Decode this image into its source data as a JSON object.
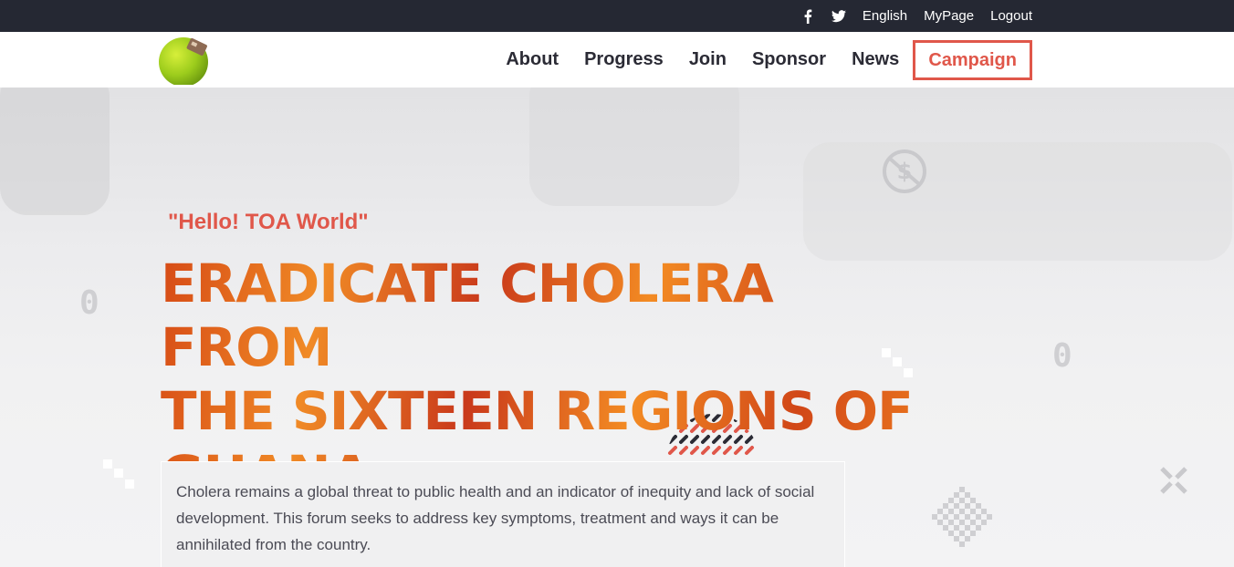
{
  "topbar": {
    "social": [
      {
        "name": "facebook-icon",
        "glyph": "f"
      },
      {
        "name": "twitter-icon",
        "glyph": "🐦"
      }
    ],
    "links": [
      {
        "label": "English"
      },
      {
        "label": "MyPage"
      },
      {
        "label": "Logout"
      }
    ]
  },
  "nav": {
    "items": [
      {
        "label": "About"
      },
      {
        "label": "Progress"
      },
      {
        "label": "Join"
      },
      {
        "label": "Sponsor"
      },
      {
        "label": "News"
      }
    ],
    "campaign": "Campaign"
  },
  "hero": {
    "tagline": "\"Hello! TOA World\"",
    "headline_lines": [
      "ERADICATE CHOLERA FROM",
      "THE SIXTEEN REGIONS OF",
      "GHANA"
    ],
    "description": "Cholera remains a global threat to public health and an indicator of inequity and lack of social development. This forum seeks to address key symptoms, treatment and ways it can be annihilated from the country.",
    "decor_digit_left": "0",
    "decor_digit_right": "0"
  },
  "colors": {
    "topbar_bg": "#252833",
    "accent": "#e0574a",
    "headline_orange": "#ef7f1f",
    "headline_red": "#c9391b"
  }
}
